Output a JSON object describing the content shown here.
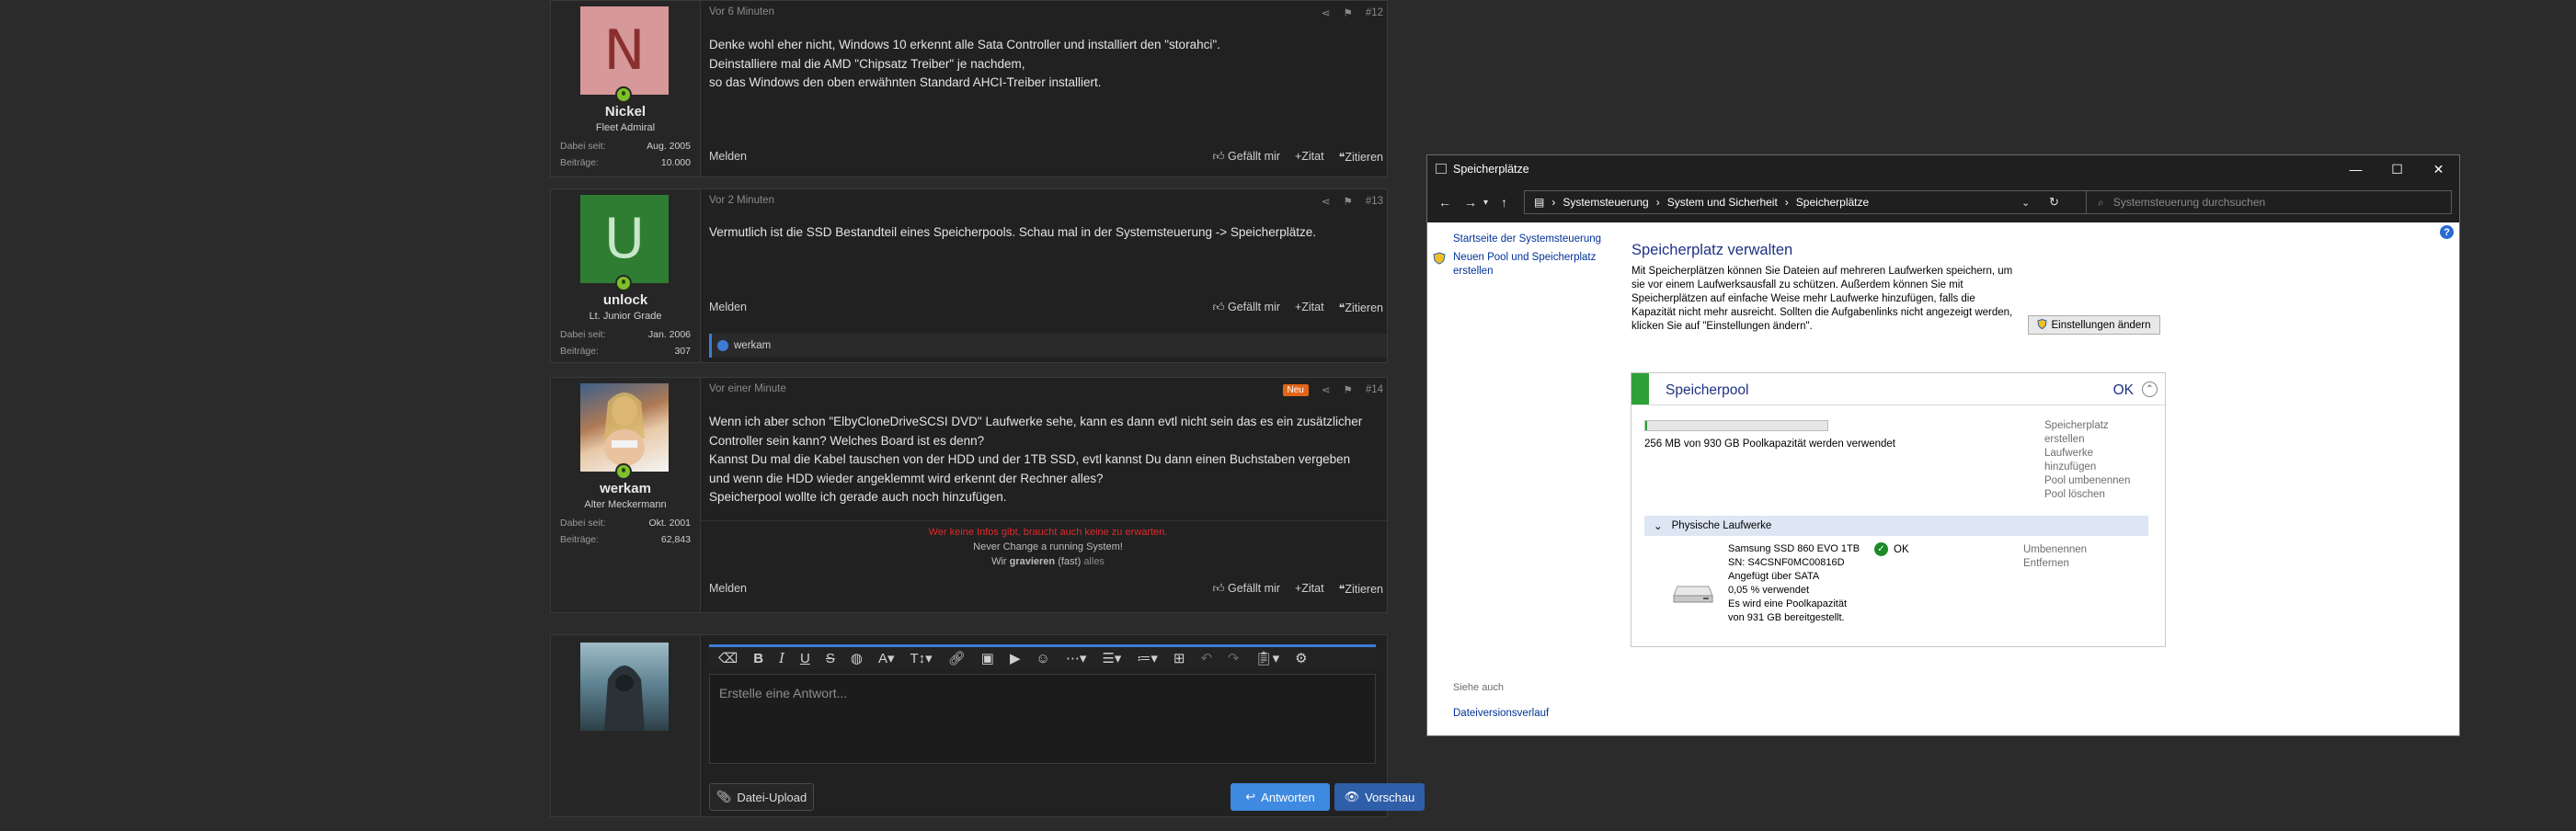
{
  "forum": {
    "posts": [
      {
        "avatar_letter": "N",
        "avatar_color": "#d69898",
        "avatar_fg": "#8a2f2f",
        "username": "Nickel",
        "user_title": "Fleet Admiral",
        "joined_label": "Dabei seit:",
        "joined": "Aug. 2005",
        "posts_label": "Beiträge:",
        "post_count": "10.000",
        "time": "Vor 6 Minuten",
        "number": "#12",
        "lines": [
          "Denke wohl eher nicht, Windows 10 erkennt alle Sata Controller und installiert den \"storahci\".",
          "Deinstalliere mal die AMD \"Chipsatz Treiber\" je nachdem,",
          "so das Windows den oben erwähnten Standard AHCI-Treiber installiert."
        ],
        "report": "Melden",
        "like": "Gefällt mir",
        "quote": "Zitat",
        "multiquote": "Zitieren"
      },
      {
        "avatar_letter": "U",
        "avatar_color": "#2e7d32",
        "avatar_fg": "#c8e6c9",
        "username": "unlock",
        "user_title": "Lt. Junior Grade",
        "joined_label": "Dabei seit:",
        "joined": "Jan. 2006",
        "posts_label": "Beiträge:",
        "post_count": "307",
        "time": "Vor 2 Minuten",
        "number": "#13",
        "lines": [
          "Vermutlich ist die SSD Bestandteil eines Speicherpools. Schau mal in der Systemsteuerung -> Speicherplätze."
        ],
        "report": "Melden",
        "like": "Gefällt mir",
        "quote": "Zitat",
        "multiquote": "Zitieren",
        "reaction_user": "werkam"
      },
      {
        "username": "werkam",
        "user_title": "Alter Meckermann",
        "joined_label": "Dabei seit:",
        "joined": "Okt. 2001",
        "posts_label": "Beiträge:",
        "post_count": "62,843",
        "time": "Vor einer Minute",
        "badge": "Neu",
        "number": "#14",
        "lines": [
          "Wenn ich aber schon \"ElbyCloneDriveSCSI DVD\" Laufwerke sehe, kann es dann evtl nicht sein das es ein zusätzlicher",
          "Controller sein kann? Welches Board ist es denn?",
          "Kannst Du mal die Kabel tauschen von der HDD und der 1TB SSD, evtl kannst Du dann einen Buchstaben vergeben",
          "und wenn die HDD wieder angeklemmt wird erkennt der Rechner alles?",
          "Speicherpool wollte ich gerade auch noch hinzufügen."
        ],
        "sig_1": "Wer keine Infos gibt, braucht auch keine zu erwarten.",
        "sig_2": "Never Change a running System!",
        "sig_3a": "Wir ",
        "sig_3b": "gravieren",
        "sig_3c": " (fast) ",
        "sig_3d": "alles",
        "report": "Melden",
        "like": "Gefällt mir",
        "quote": "Zitat",
        "multiquote": "Zitieren"
      }
    ],
    "editor": {
      "placeholder": "Erstelle eine Antwort...",
      "upload": "Datei-Upload",
      "reply": "Antworten",
      "preview": "Vorschau"
    }
  },
  "window": {
    "title": "Speicherplätze",
    "breadcrumb": [
      "Systemsteuerung",
      "System und Sicherheit",
      "Speicherplätze"
    ],
    "search_placeholder": "Systemsteuerung durchsuchen",
    "left_home": "Startseite der Systemsteuerung",
    "left_new_pool_1": "Neuen Pool und Speicherplatz",
    "left_new_pool_2": "erstellen",
    "see_also": "Siehe auch",
    "file_history": "Dateiversionsverlauf",
    "heading": "Speicherplatz verwalten",
    "intro": "Mit Speicherplätzen können Sie Dateien auf mehreren Laufwerken speichern, um sie vor einem Laufwerksausfall zu schützen. Außerdem können Sie mit Speicherplätzen auf einfache Weise mehr Laufwerke hinzufügen, falls die Kapazität nicht mehr ausreicht. Sollten die Aufgabenlinks nicht angezeigt werden, klicken Sie auf \"Einstellungen ändern\".",
    "change_settings": "Einstellungen ändern",
    "pool": {
      "name": "Speicherpool",
      "status": "OK",
      "usage_fraction": 0.003,
      "usage_text": "256 MB von 930 GB Poolkapazität werden verwendet",
      "actions": [
        "Speicherplatz",
        "erstellen",
        "Laufwerke",
        "hinzufügen",
        "Pool umbenennen",
        "Pool löschen"
      ],
      "drives_header": "Physische Laufwerke",
      "drive": {
        "name": "Samsung SSD 860 EVO 1TB",
        "sn": "SN: S4CSNF0MC00816D",
        "bus": "Angefügt über SATA",
        "used": "0,05 % verwendet",
        "cap_1": "Es wird eine Poolkapazität",
        "cap_2": "von 931 GB bereitgestellt.",
        "status": "OK",
        "rename": "Umbenennen",
        "remove": "Entfernen"
      }
    }
  }
}
